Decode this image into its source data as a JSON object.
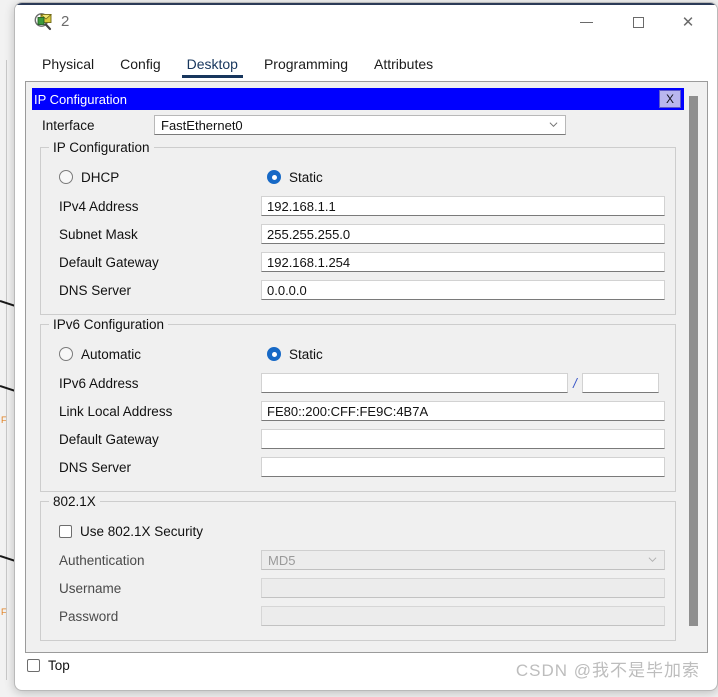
{
  "window": {
    "title": "2",
    "icon": "packet-tracer-device-icon",
    "controls": {
      "minimize": "—",
      "maximize": "☐",
      "close": "✕"
    }
  },
  "tabs": [
    {
      "label": "Physical",
      "active": false
    },
    {
      "label": "Config",
      "active": false
    },
    {
      "label": "Desktop",
      "active": true
    },
    {
      "label": "Programming",
      "active": false
    },
    {
      "label": "Attributes",
      "active": false
    }
  ],
  "ip_config_tool": {
    "caption": "IP Configuration",
    "close_label": "X",
    "interface": {
      "label": "Interface",
      "value": "FastEthernet0",
      "chevron": "chevron-down-icon"
    },
    "ipv4": {
      "group_title": "IP Configuration",
      "mode_dhcp": "DHCP",
      "mode_static": "Static",
      "selected_mode": "Static",
      "fields": [
        {
          "label": "IPv4 Address",
          "value": "192.168.1.1"
        },
        {
          "label": "Subnet Mask",
          "value": "255.255.255.0"
        },
        {
          "label": "Default Gateway",
          "value": "192.168.1.254"
        },
        {
          "label": "DNS Server",
          "value": "0.0.0.0"
        }
      ]
    },
    "ipv6": {
      "group_title": "IPv6 Configuration",
      "mode_automatic": "Automatic",
      "mode_static": "Static",
      "selected_mode": "Static",
      "address_label": "IPv6 Address",
      "address_value": "",
      "prefix_separator": "/",
      "prefix_value": "",
      "fields": [
        {
          "label": "Link Local Address",
          "value": "FE80::200:CFF:FE9C:4B7A"
        },
        {
          "label": "Default Gateway",
          "value": ""
        },
        {
          "label": "DNS Server",
          "value": ""
        }
      ]
    },
    "dot1x": {
      "group_title": "802.1X",
      "use_security_label": "Use 802.1X Security",
      "use_security_checked": false,
      "authentication_label": "Authentication",
      "authentication_value": "MD5",
      "username_label": "Username",
      "username_value": "",
      "password_label": "Password",
      "password_value": ""
    }
  },
  "bottom": {
    "top_checkbox_label": "Top",
    "top_checked": false
  },
  "watermark": "CSDN @我不是毕加索",
  "background_fragments": {
    "text_1": "F",
    "text_2": "F"
  },
  "colors": {
    "caption_blue": "#0000FF",
    "radio_blue": "#1769C6",
    "tab_active": "#17365D",
    "panel_grey": "#F0F0F0",
    "close_btn_lavender": "#B9B6EE"
  }
}
